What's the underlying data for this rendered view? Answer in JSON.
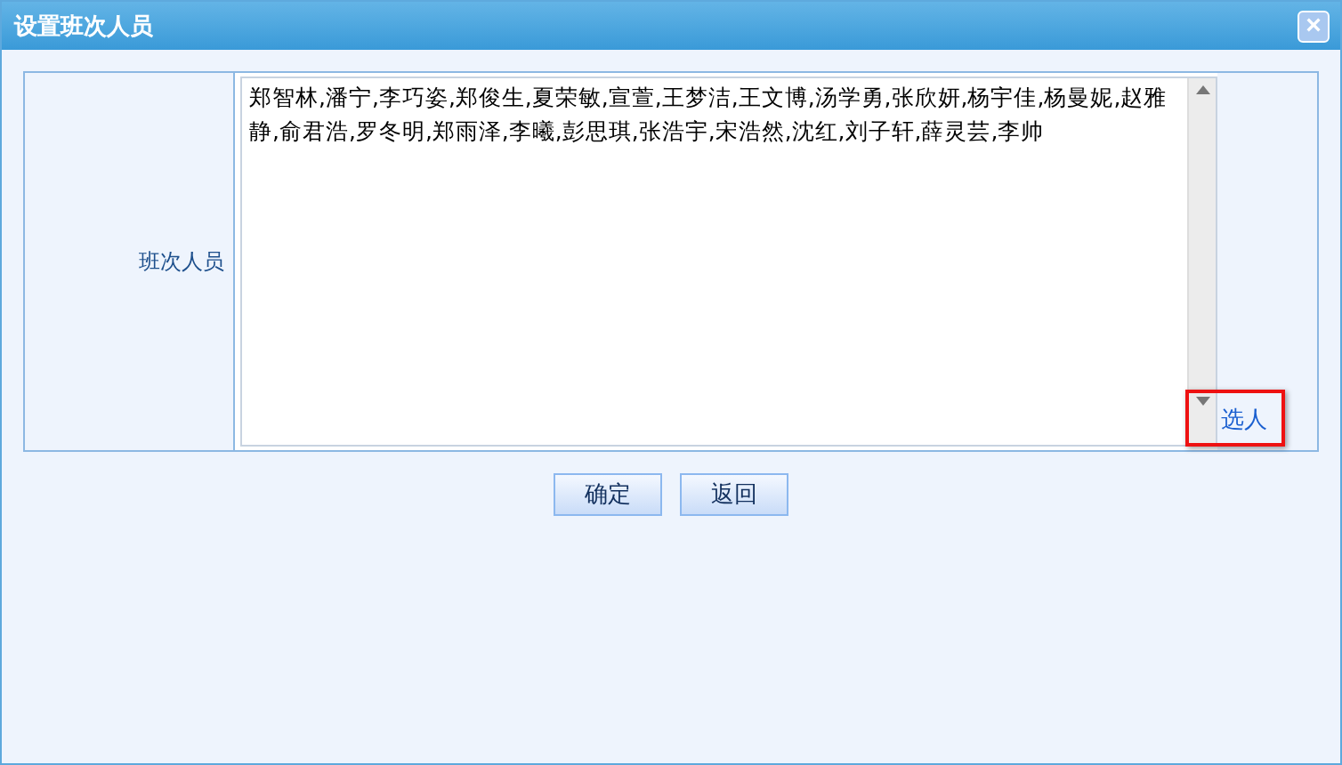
{
  "window": {
    "title": "设置班次人员",
    "close": "×"
  },
  "form": {
    "label": "班次人员",
    "value": "郑智林,潘宁,李巧姿,郑俊生,夏荣敏,宣萱,王梦洁,王文博,汤学勇,张欣妍,杨宇佳,杨曼妮,赵雅静,俞君浩,罗冬明,郑雨泽,李曦,彭思琪,张浩宇,宋浩然,沈红,刘子轩,薛灵芸,李帅",
    "link": "选人",
    "link_highlighted": true
  },
  "buttons": [
    "确定",
    "返回"
  ]
}
